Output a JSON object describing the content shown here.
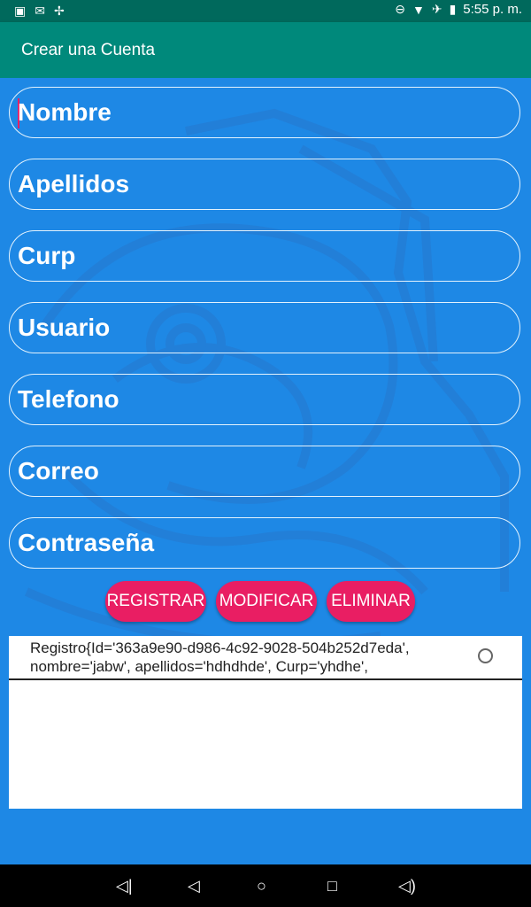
{
  "status_bar": {
    "time": "5:55 p. m.",
    "left_icons": [
      "photo-icon",
      "mail-icon",
      "fan-icon"
    ],
    "right_icons": [
      "do-not-disturb-icon",
      "wifi-icon",
      "airplane-icon",
      "battery-icon"
    ]
  },
  "app_bar": {
    "title": "Crear una Cuenta"
  },
  "form": {
    "fields": [
      {
        "name": "nombre",
        "placeholder": "Nombre"
      },
      {
        "name": "apellidos",
        "placeholder": "Apellidos"
      },
      {
        "name": "curp",
        "placeholder": "Curp"
      },
      {
        "name": "usuario",
        "placeholder": "Usuario"
      },
      {
        "name": "telefono",
        "placeholder": "Telefono"
      },
      {
        "name": "correo",
        "placeholder": "Correo"
      },
      {
        "name": "contrasena",
        "placeholder": "Contraseña"
      }
    ]
  },
  "buttons": {
    "registrar": "REGISTRAR",
    "modificar": "MODIFICAR",
    "eliminar": "ELIMINAR"
  },
  "records": {
    "items": [
      {
        "line1": "Registro{Id='363a9e90-d986-4c92-9028-504b252d7eda',",
        "line2": "nombre='jabw', apellidos='hdhdhde', Curp='yhdhe',"
      }
    ]
  },
  "colors": {
    "status_bar": "#00695c",
    "app_bar": "#00897b",
    "background": "#1e88e5",
    "accent": "#e91e63"
  },
  "nav_bar": {
    "icons": [
      "volume-down-icon",
      "back-icon",
      "home-icon",
      "recents-icon",
      "volume-up-icon"
    ]
  }
}
